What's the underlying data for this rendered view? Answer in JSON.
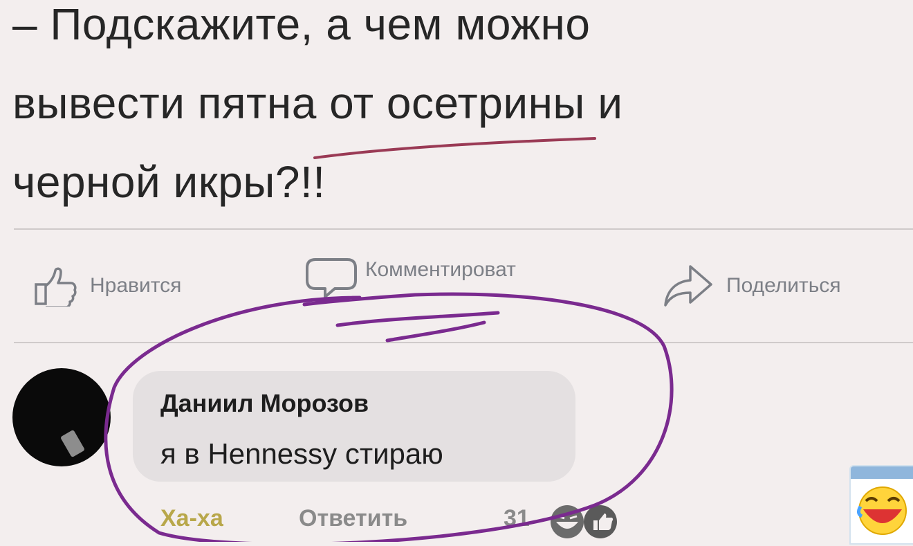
{
  "post": {
    "lines": [
      "– Подскажите, а чем можно",
      "вывести пятна от осетрины и",
      "черной икры?!!"
    ]
  },
  "actions": {
    "like": "Нравится",
    "comment": "Комментироват",
    "share": "Поделиться"
  },
  "comment": {
    "author": "Даниил Морозов",
    "text": "я в Hennessy стираю",
    "reaction_label": "Ха-ха",
    "reply_label": "Ответить",
    "reactions_count": "31"
  },
  "colors": {
    "background": "#f3eeee",
    "annotation_stroke": "#7a2a8f",
    "underline_stroke": "#9a3a55"
  },
  "icons": [
    "thumbs-up-icon",
    "comment-bubble-icon",
    "share-arrow-icon",
    "laughing-emoji-icon",
    "like-badge-icon"
  ]
}
